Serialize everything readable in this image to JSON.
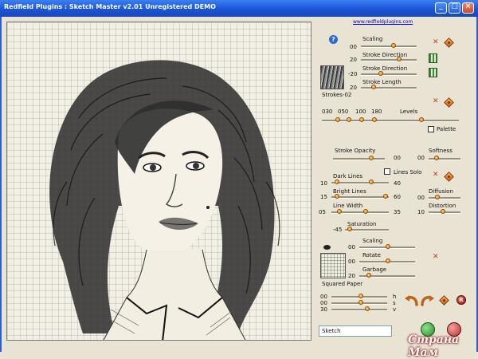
{
  "window": {
    "title": "Redfield Plugins : Sketch Master v2.01   Unregistered  DEMO",
    "minimize_glyph": "_",
    "maximize_glyph": "□",
    "close_glyph": "×"
  },
  "link": "www.redfieldplugins.com",
  "help_glyph": "?",
  "panel": {
    "scaling": {
      "label": "Scaling",
      "value": "00"
    },
    "stroke_direction_1": {
      "label": "Stroke Direction",
      "value": "20"
    },
    "stroke_direction_2": {
      "label": "Stroke Direction",
      "value": "-20"
    },
    "stroke_length": {
      "label": "Stroke Length",
      "value": "20"
    },
    "stroke_preset": "Strokes-02",
    "levels": {
      "label": "Levels",
      "values": [
        "030",
        "050",
        "100",
        "180"
      ]
    },
    "palette_label": "Palette",
    "stroke_opacity": {
      "label": "Stroke Opacity",
      "value": "00"
    },
    "softness": {
      "label": "Softness",
      "value": "00"
    },
    "dark_lines": {
      "label": "Dark Lines",
      "min": "10",
      "max": "40"
    },
    "lines_solo_label": "Lines Solo",
    "bright_lines": {
      "label": "Bright Lines",
      "min": "15",
      "max": "60"
    },
    "diffusion": {
      "label": "Diffusion",
      "value": "00"
    },
    "line_width": {
      "label": "Line Width",
      "min": "05",
      "max": "35"
    },
    "distortion": {
      "label": "Distortion",
      "value": "10"
    },
    "saturation": {
      "label": "Saturation",
      "value": "-45"
    },
    "paper_scaling": {
      "label": "Scaling",
      "value": "00"
    },
    "rotate": {
      "label": "Rotate",
      "value": "00"
    },
    "garbage": {
      "label": "Garbage",
      "value": "20"
    },
    "paper_name": "Squared Paper",
    "hsv": [
      {
        "value": "00",
        "letter": "h"
      },
      {
        "value": "00",
        "letter": "s"
      },
      {
        "value": "30",
        "letter": "v"
      }
    ],
    "reset_glyph": "R",
    "preset_value": "Sketch"
  },
  "watermark": "Страна Мам",
  "colors": {
    "titlebar": "#1b55d8",
    "panel_bg": "#e9e3d3",
    "accent_orange": "#d87f14",
    "close_red": "#c23a2a"
  }
}
